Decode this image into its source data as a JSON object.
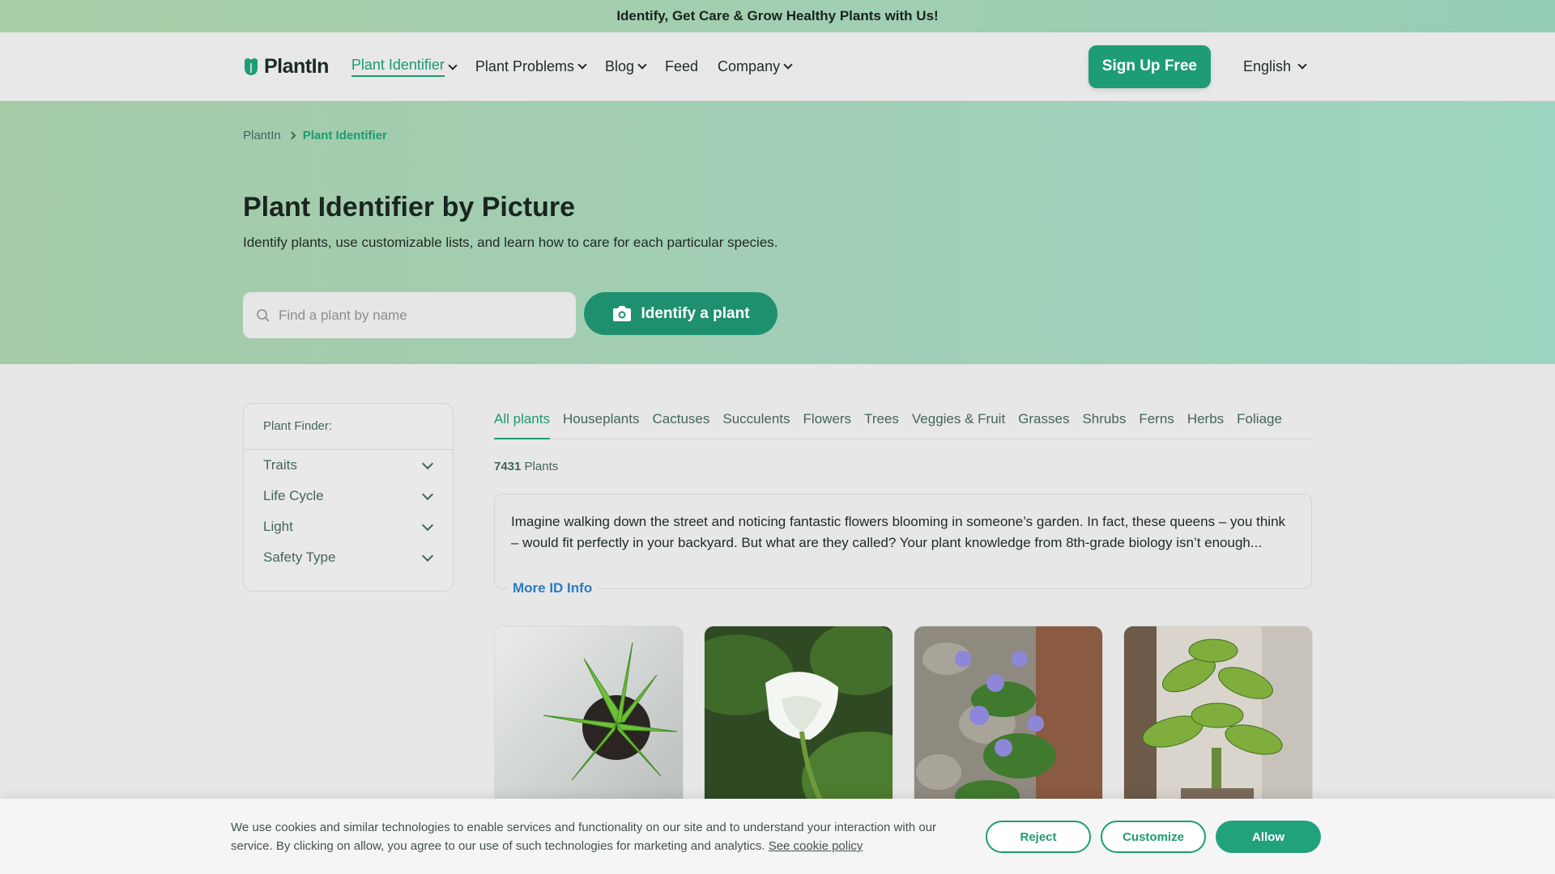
{
  "promo": {
    "text": "Identify, Get Care & Grow Healthy Plants with Us!"
  },
  "nav": {
    "logo": "PlantIn",
    "items": [
      {
        "label": "Plant Identifier",
        "has_dropdown": true,
        "active": true
      },
      {
        "label": "Plant Problems",
        "has_dropdown": true
      },
      {
        "label": "Blog",
        "has_dropdown": true
      },
      {
        "label": "Feed",
        "has_dropdown": false
      },
      {
        "label": "Company",
        "has_dropdown": true
      }
    ],
    "signup": "Sign Up Free",
    "language": "English"
  },
  "breadcrumb": {
    "home": "PlantIn",
    "current": "Plant Identifier"
  },
  "hero": {
    "title": "Plant Identifier by Picture",
    "subtitle": "Identify plants, use customizable lists, and learn how to care for each particular species.",
    "search_placeholder": "Find a plant by name",
    "identify_button": "Identify a plant"
  },
  "finder": {
    "title": "Plant Finder:",
    "filters": [
      "Traits",
      "Life Cycle",
      "Light",
      "Safety Type"
    ]
  },
  "tabs": [
    "All plants",
    "Houseplants",
    "Cactuses",
    "Succulents",
    "Flowers",
    "Trees",
    "Veggies & Fruit",
    "Grasses",
    "Shrubs",
    "Ferns",
    "Herbs",
    "Foliage"
  ],
  "active_tab": "All plants",
  "count": {
    "number": "7431",
    "label": "Plants"
  },
  "info": {
    "text": "Imagine walking down the street and noticing fantastic flowers blooming in someone’s garden. In fact, these queens – you think – would fit perfectly in your backyard. But what are they called? Your plant knowledge from 8th-grade biology isn’t enough...",
    "more": "More ID Info"
  },
  "cards": [
    {
      "icon": "aloe-plant-photo"
    },
    {
      "icon": "white-flower-photo"
    },
    {
      "icon": "periwinkle-wall-photo"
    },
    {
      "icon": "dieffenbachia-photo"
    }
  ],
  "cookie": {
    "text": "We use cookies and similar technologies to enable services and functionality on our site and to understand your interaction with our service. By clicking on allow, you agree to our use of such technologies for marketing and analytics.",
    "link": "See cookie policy",
    "reject": "Reject",
    "customize": "Customize",
    "allow": "Allow"
  },
  "colors": {
    "brand": "#1e9c75",
    "link": "#2d7ac0"
  }
}
